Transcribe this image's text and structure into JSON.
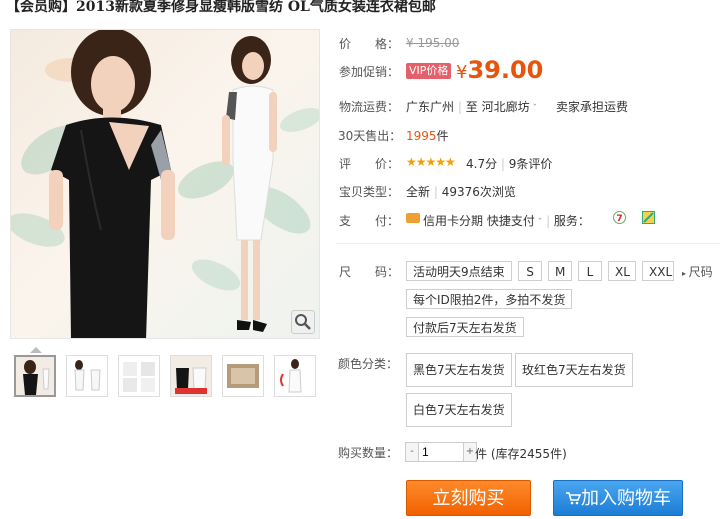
{
  "title": "【会员购】2013新款夏季修身显瘦韩版雪纺 OL气质女装连衣裙包邮",
  "price": {
    "label": "价　　格：",
    "original": "¥ 195.00",
    "promo_label": "参加促销：",
    "vip_tag": "VIP价格",
    "currency": "¥",
    "value": "39.00"
  },
  "shipping": {
    "label": "物流运费：",
    "from": "广东广州",
    "sep": "至",
    "to": "河北廊坊",
    "note": "卖家承担运费"
  },
  "sales": {
    "label": "30天售出：",
    "count": "1995",
    "unit": "件"
  },
  "rating": {
    "label": "评　　价：",
    "stars": "★★★★★",
    "score": "4.7分",
    "sep": "|",
    "reviews": "9条评价",
    "score_value": 4.7
  },
  "type": {
    "label": "宝贝类型：",
    "condition": "全新",
    "sep": "|",
    "views": "49376次浏览"
  },
  "payment": {
    "label": "支　　付：",
    "installment": "信用卡分期",
    "quick": "快捷支付",
    "service_label": "服务："
  },
  "size": {
    "label": "尺　　码：",
    "options": [
      "活动明天9点结束",
      "S",
      "M",
      "L",
      "XL",
      "XXL"
    ],
    "size_chart": "尺码",
    "note1": "每个ID限拍2件，多拍不发货",
    "note2": "付款后7天左右发货"
  },
  "color": {
    "label": "颜色分类：",
    "options": [
      "黑色7天左右发货",
      "玫红色7天左右发货",
      "白色7天左右发货"
    ]
  },
  "quantity": {
    "label": "购买数量：",
    "value": "1",
    "unit": "件",
    "stock": "(库存2455件)"
  },
  "actions": {
    "buy": "立刻购买",
    "cart": "加入购物车"
  },
  "colors": {
    "accent": "#e8540c",
    "buy": "#f26100",
    "cart": "#1c7dd6",
    "vip": "#e4606a"
  }
}
